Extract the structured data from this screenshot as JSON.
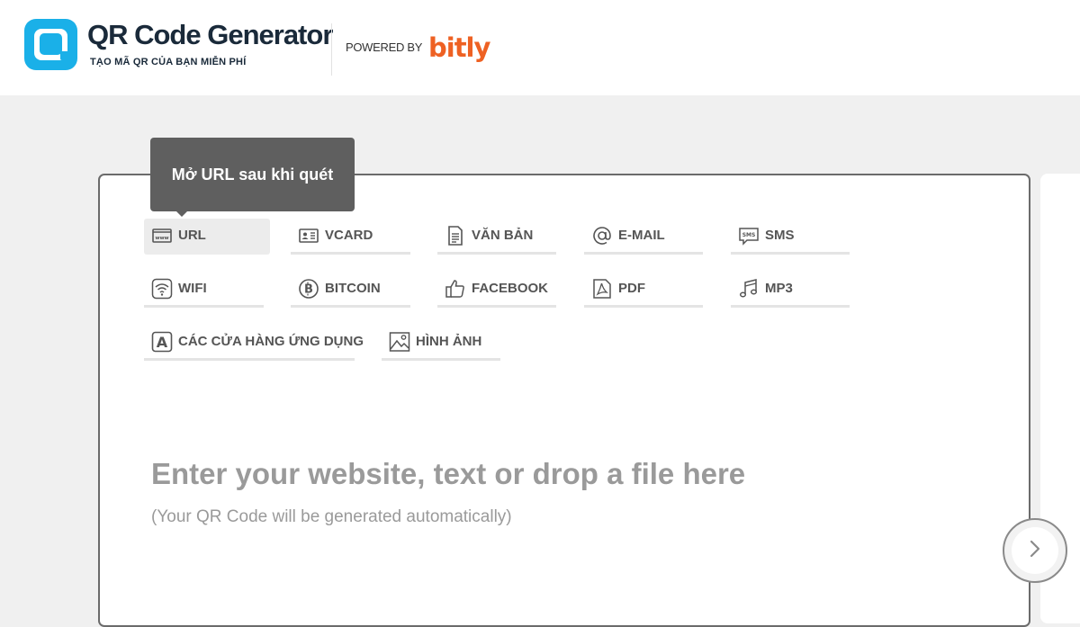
{
  "header": {
    "brand_title": "QR Code Generator",
    "brand_subtitle": "TẠO MÃ QR CỦA BẠN MIỄN PHÍ",
    "powered_by": "POWERED BY",
    "partner_logo": "bitly",
    "colors": {
      "logo_blue": "#1ab0e8",
      "bitly_orange": "#ee6123"
    }
  },
  "tooltip": {
    "text": "Mở URL sau khi quét"
  },
  "tabs": [
    {
      "label": "URL",
      "icon": "www-icon",
      "active": true
    },
    {
      "label": "VCARD",
      "icon": "vcard-icon"
    },
    {
      "label": "VĂN BẢN",
      "icon": "text-document-icon"
    },
    {
      "label": "E-MAIL",
      "icon": "at-icon"
    },
    {
      "label": "SMS",
      "icon": "sms-icon"
    },
    {
      "label": "WIFI",
      "icon": "wifi-icon"
    },
    {
      "label": "BITCOIN",
      "icon": "bitcoin-icon"
    },
    {
      "label": "FACEBOOK",
      "icon": "thumbs-up-icon"
    },
    {
      "label": "PDF",
      "icon": "pdf-icon"
    },
    {
      "label": "MP3",
      "icon": "music-note-icon"
    },
    {
      "label": "CÁC CỬA HÀNG ỨNG DỤNG",
      "icon": "app-store-icon"
    },
    {
      "label": "HÌNH ẢNH",
      "icon": "image-icon"
    }
  ],
  "input": {
    "prompt": "Enter your website, text or drop a file here",
    "hint": "(Your QR Code will be generated automatically)"
  },
  "next_button": {
    "icon": "chevron-right-icon"
  }
}
